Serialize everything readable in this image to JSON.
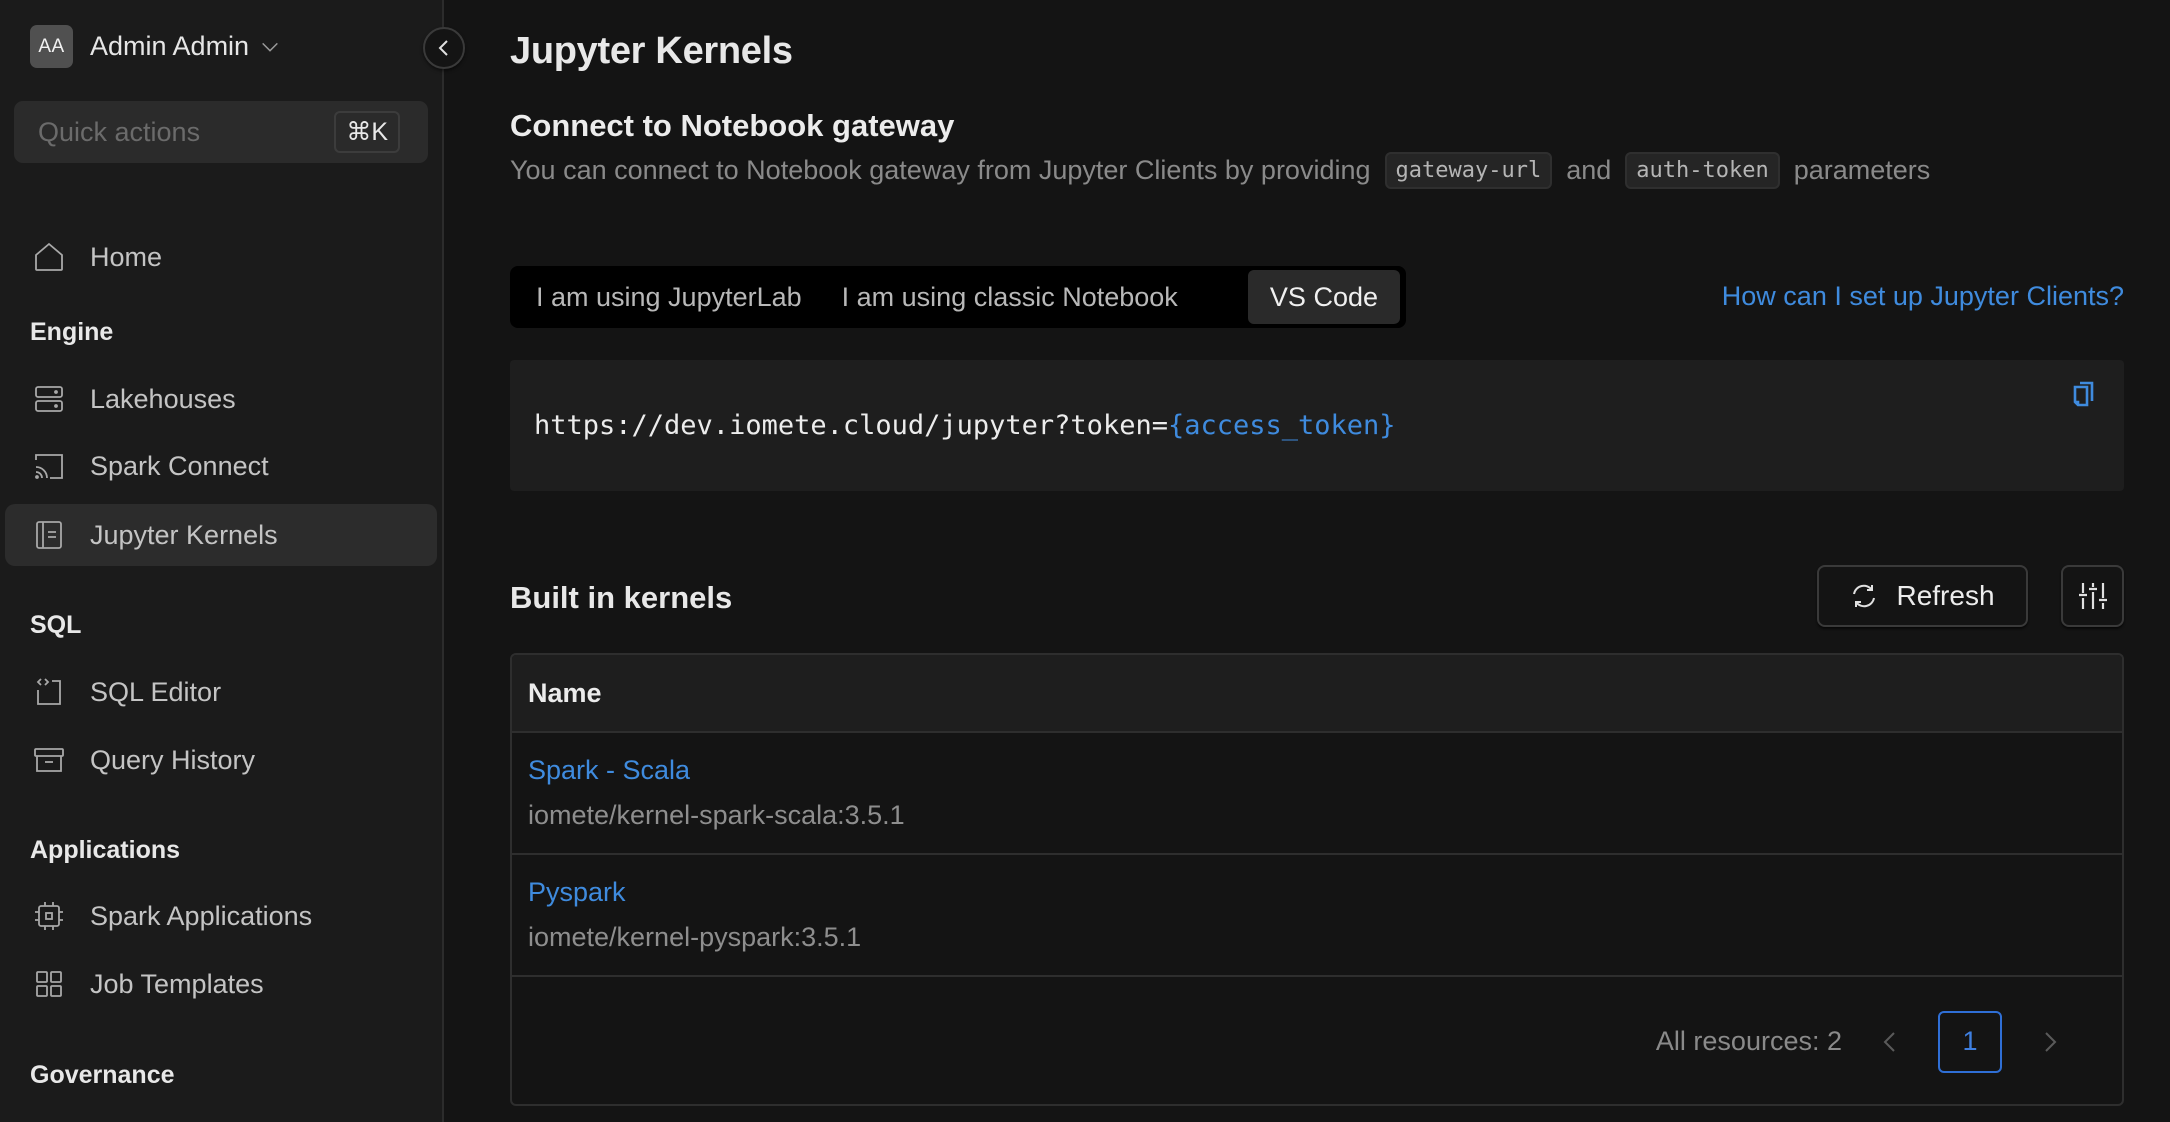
{
  "user": {
    "initials": "AA",
    "name": "Admin Admin"
  },
  "quick_actions": {
    "placeholder": "Quick actions",
    "shortcut": "⌘K"
  },
  "sidebar": {
    "sections": [
      {
        "items": [
          {
            "label": "Home",
            "icon": "home-icon"
          }
        ]
      },
      {
        "title": "Engine",
        "items": [
          {
            "label": "Lakehouses",
            "icon": "server-icon"
          },
          {
            "label": "Spark Connect",
            "icon": "cast-icon"
          },
          {
            "label": "Jupyter Kernels",
            "icon": "notebook-icon",
            "active": true
          }
        ]
      },
      {
        "title": "SQL",
        "items": [
          {
            "label": "SQL Editor",
            "icon": "code-file-icon"
          },
          {
            "label": "Query History",
            "icon": "archive-icon"
          }
        ]
      },
      {
        "title": "Applications",
        "items": [
          {
            "label": "Spark Applications",
            "icon": "chip-icon"
          },
          {
            "label": "Job Templates",
            "icon": "grid-icon"
          }
        ]
      },
      {
        "title": "Governance",
        "items": []
      }
    ]
  },
  "page": {
    "title": "Jupyter Kernels",
    "gateway": {
      "title": "Connect to Notebook gateway",
      "desc_prefix": "You can connect to Notebook gateway from Jupyter Clients by providing",
      "param1": "gateway-url",
      "desc_and": "and",
      "param2": "auth-token",
      "desc_suffix": "parameters"
    },
    "tabs": [
      {
        "label": "I am using JupyterLab",
        "active": false
      },
      {
        "label": "I am using classic Notebook",
        "active": false
      },
      {
        "label": "VS Code",
        "active": true
      }
    ],
    "help_link": "How can I set up Jupyter Clients?",
    "code": {
      "url": "https://dev.iomete.cloud/jupyter?token=",
      "variable": "{access_token}"
    },
    "kernels": {
      "title": "Built in kernels",
      "refresh_label": "Refresh",
      "columns": [
        "Name"
      ],
      "rows": [
        {
          "name": "Spark - Scala",
          "image": "iomete/kernel-spark-scala:3.5.1"
        },
        {
          "name": "Pyspark",
          "image": "iomete/kernel-pyspark:3.5.1"
        }
      ],
      "total_label": "All resources: 2",
      "current_page": "1"
    }
  },
  "colors": {
    "accent": "#3f8bde",
    "sidebar_bg": "#1b1b1b",
    "main_bg": "#141414",
    "active_item": "#2c2c2c"
  }
}
